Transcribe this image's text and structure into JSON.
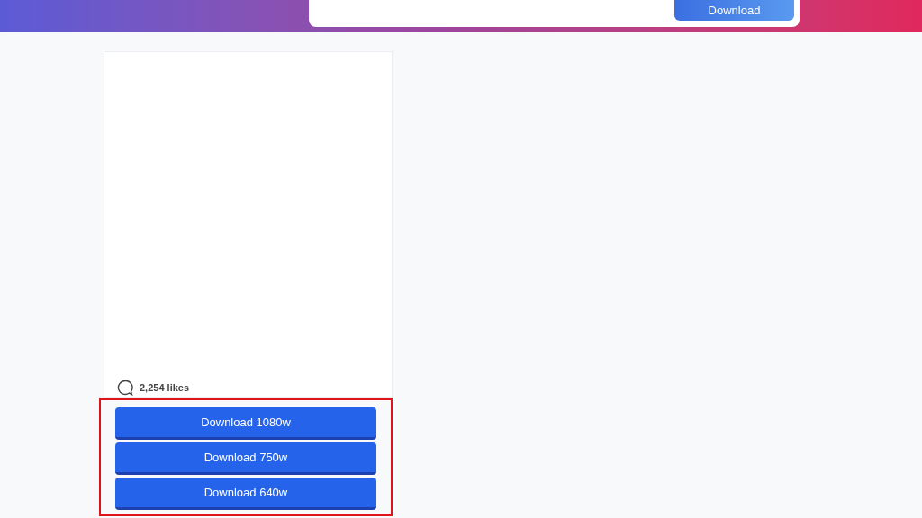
{
  "header": {
    "button": "Download"
  },
  "post": {
    "likes": "2,254 likes",
    "downloads": [
      {
        "label": "Download 1080w"
      },
      {
        "label": "Download 750w"
      },
      {
        "label": "Download 640w"
      }
    ]
  }
}
